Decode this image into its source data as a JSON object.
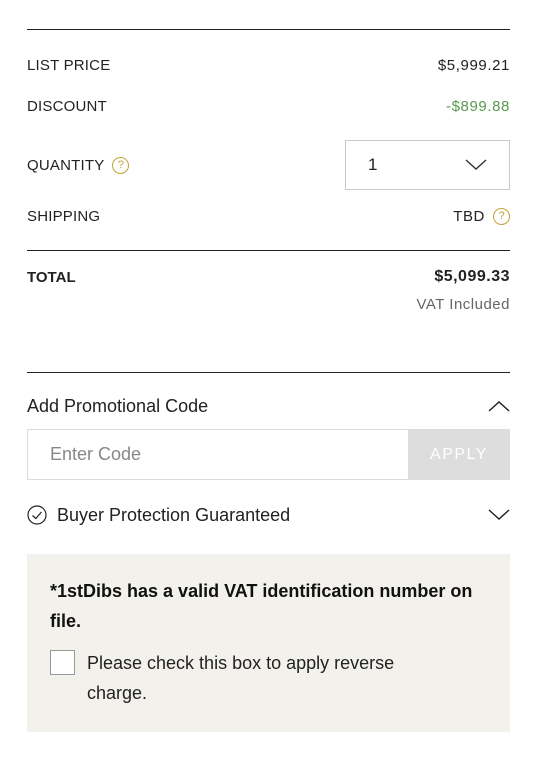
{
  "summary": {
    "list_price_label": "LIST PRICE",
    "list_price_value": "$5,999.21",
    "discount_label": "DISCOUNT",
    "discount_value": "-$899.88",
    "quantity_label": "QUANTITY",
    "quantity_value": "1",
    "shipping_label": "SHIPPING",
    "shipping_value": "TBD",
    "help_glyph": "?",
    "total_label": "TOTAL",
    "total_value": "$5,099.33",
    "vat_note": "VAT Included"
  },
  "promo": {
    "title": "Add Promotional Code",
    "placeholder": "Enter Code",
    "apply_label": "APPLY"
  },
  "buyer_protection": {
    "label": "Buyer Protection Guaranteed"
  },
  "vat_panel": {
    "note": "*1stDibs has a valid VAT identification number on file.",
    "checkbox_label": "Please check this box to apply reverse charge.",
    "checked": false
  },
  "colors": {
    "discount": "#5a9a4f",
    "help_icon": "#c2a33a",
    "panel_bg": "#f3f1ec",
    "apply_bg": "#dddddd"
  },
  "icons": {
    "help": "help-icon",
    "quantity_caret": "chevron-down-icon",
    "promo_caret": "chevron-up-icon",
    "buyer_protection": "check-circle-icon",
    "buyer_caret": "chevron-down-icon"
  }
}
